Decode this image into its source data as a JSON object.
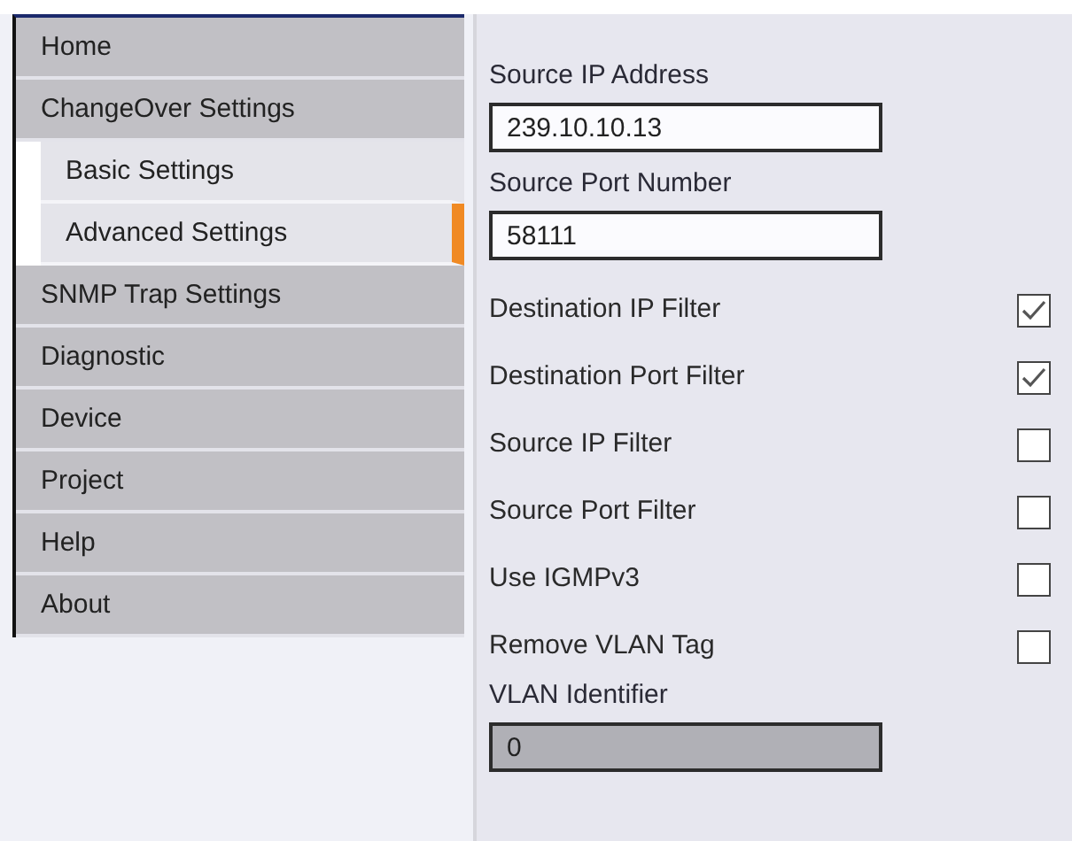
{
  "sidebar": {
    "items": [
      {
        "label": "Home",
        "selected": false
      },
      {
        "label": "ChangeOver Settings",
        "selected": false,
        "children": [
          {
            "label": "Basic Settings",
            "selected": false
          },
          {
            "label": "Advanced Settings",
            "selected": true
          }
        ]
      },
      {
        "label": "SNMP Trap Settings",
        "selected": false
      },
      {
        "label": "Diagnostic",
        "selected": false
      },
      {
        "label": "Device",
        "selected": false
      },
      {
        "label": "Project",
        "selected": false
      },
      {
        "label": "Help",
        "selected": false
      },
      {
        "label": "About",
        "selected": false
      }
    ]
  },
  "settings": [
    {
      "kind": "text",
      "label": "Source IP Address",
      "value": "239.10.10.13",
      "disabled": false
    },
    {
      "kind": "text",
      "label": "Source Port Number",
      "value": "58111",
      "disabled": false
    },
    {
      "kind": "checkbox",
      "label": "Destination IP Filter",
      "checked": true
    },
    {
      "kind": "checkbox",
      "label": "Destination Port Filter",
      "checked": true
    },
    {
      "kind": "checkbox",
      "label": "Source IP Filter",
      "checked": false
    },
    {
      "kind": "checkbox",
      "label": "Source Port Filter",
      "checked": false
    },
    {
      "kind": "checkbox",
      "label": "Use IGMPv3",
      "checked": false
    },
    {
      "kind": "checkbox",
      "label": "Remove VLAN Tag",
      "checked": false
    },
    {
      "kind": "text",
      "label": "VLAN Identifier",
      "value": "0",
      "disabled": true
    }
  ]
}
